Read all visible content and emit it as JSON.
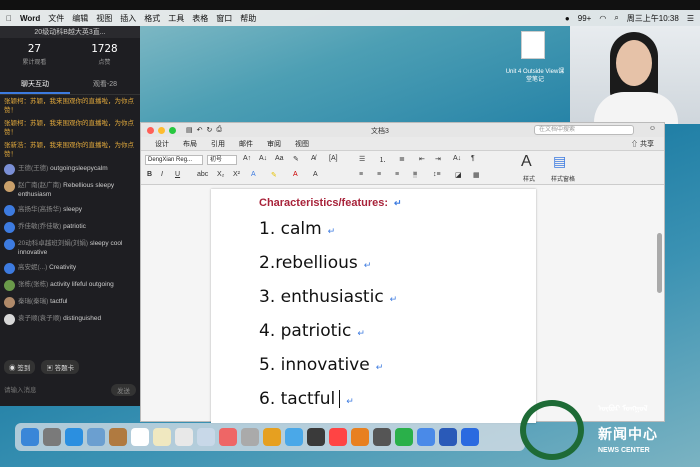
{
  "menubar": {
    "app": "Word",
    "items": [
      "文件",
      "编辑",
      "视图",
      "插入",
      "格式",
      "工具",
      "表格",
      "窗口",
      "帮助"
    ],
    "battery": "99+",
    "clock": "周三上午10:38"
  },
  "chat": {
    "title": "20级动科B越大英3直...",
    "views": "27",
    "views_label": "累计观看",
    "likes": "1728",
    "likes_label": "点赞",
    "tab_chat": "聊天互动",
    "tab_watch": "观看-28",
    "system": [
      "张颖柯：苏颖，我来围观你的直播啦，为你点赞！",
      "张颖柯：苏颖，我来围观你的直播啦，为你点赞！",
      "张新浩：苏颖，我来围观你的直播啦，为你点赞！"
    ],
    "messages": [
      {
        "name": "王德(王德)",
        "text": "outgoingsleepycalm"
      },
      {
        "name": "赵广南(赵广南)",
        "text": "Rebellious sleepy enthusiasm"
      },
      {
        "name": "高扬华(高扬华)",
        "text": "sleepy"
      },
      {
        "name": "乔佳敏(乔佳敏)",
        "text": "patriotic"
      },
      {
        "name": "20动科卓越班刘娟(刘娟)",
        "text": "sleepy cool innovative"
      },
      {
        "name": "高安妮(...)",
        "text": "Creativity"
      },
      {
        "name": "张栋(张栋)",
        "text": "activity lifeful outgoing"
      },
      {
        "name": "秦瑞(秦瑞)",
        "text": "tactful"
      },
      {
        "name": "袁子顺(袁子顺)",
        "text": "distinguished"
      }
    ],
    "chip_signin": "签到",
    "chip_answer": "答题卡",
    "input_placeholder": "请输入消息",
    "send": "发送"
  },
  "word": {
    "doc_title": "文档3",
    "search_placeholder": "在文档中搜索",
    "tabs": [
      "设计",
      "布局",
      "引用",
      "邮件",
      "审阅",
      "视图"
    ],
    "share": "共享",
    "font": "DengXian Reg...",
    "size": "初号",
    "styles": "样式",
    "styles_pane": "样式窗格",
    "heading": "Characteristics/features:",
    "items": [
      "1. calm",
      "2.rebellious",
      "3. enthusiastic",
      "4. patriotic",
      "5. innovative",
      "6. tactful"
    ]
  },
  "desktop": {
    "file_label": "Unit 4 Outside View课堂笔记"
  },
  "watermark": {
    "top": "ᠦᠪᠦᠷ ᠮᠣᠩᠭᠣᠯ",
    "main": "新闻中心",
    "sub": "NEWS CENTER"
  }
}
